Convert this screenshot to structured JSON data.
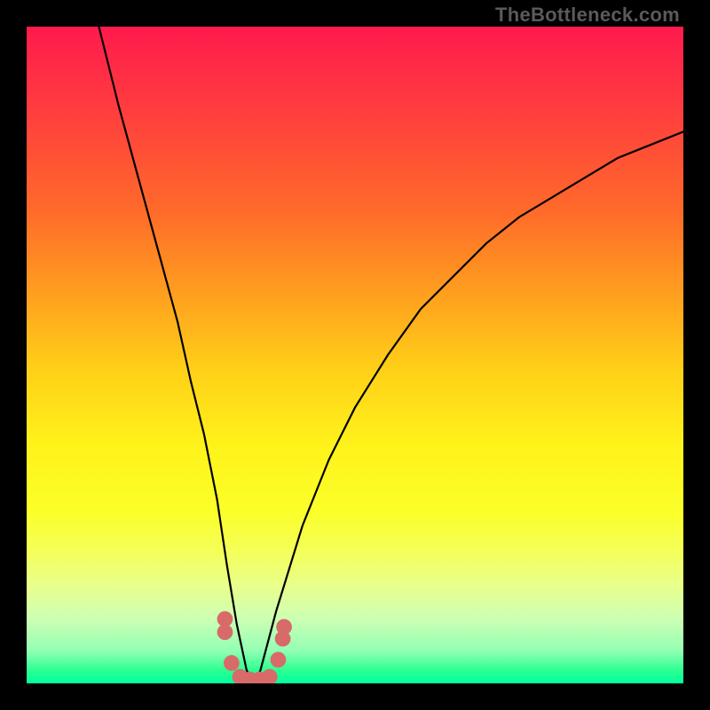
{
  "watermark": "TheBottleneck.com",
  "chart_data": {
    "type": "line",
    "title": "",
    "xlabel": "",
    "ylabel": "",
    "xlim": [
      0,
      100
    ],
    "ylim": [
      0,
      100
    ],
    "background": {
      "type": "vertical-gradient",
      "stops": [
        {
          "pct": 0,
          "color": "#ff1a4d"
        },
        {
          "pct": 28,
          "color": "#ff6a2a"
        },
        {
          "pct": 52,
          "color": "#ffcf18"
        },
        {
          "pct": 74,
          "color": "#fbff2a"
        },
        {
          "pct": 90,
          "color": "#cfffb3"
        },
        {
          "pct": 100,
          "color": "#00ff9e"
        }
      ]
    },
    "series": [
      {
        "name": "curve",
        "color": "#000000",
        "x": [
          11,
          14,
          17,
          20,
          23,
          25,
          27,
          29,
          30.5,
          32,
          33.5,
          34.6,
          35.6,
          38,
          42,
          46,
          50,
          55,
          60,
          65,
          70,
          75,
          80,
          85,
          90,
          95,
          100
        ],
        "y": [
          100,
          88,
          77,
          66,
          55,
          46,
          38,
          28,
          18,
          9,
          2,
          0,
          2,
          11,
          24,
          34,
          42,
          50,
          57,
          62,
          67,
          71,
          74,
          77,
          80,
          82,
          84
        ]
      }
    ],
    "markers": {
      "name": "bottom-cluster",
      "color": "#d86a6a",
      "radius_pct": 1.2,
      "points": [
        {
          "x": 30.2,
          "y": 9.8
        },
        {
          "x": 30.2,
          "y": 7.8
        },
        {
          "x": 31.2,
          "y": 3.1
        },
        {
          "x": 32.5,
          "y": 1.0
        },
        {
          "x": 34.0,
          "y": 0.6
        },
        {
          "x": 35.5,
          "y": 0.6
        },
        {
          "x": 37.0,
          "y": 1.0
        },
        {
          "x": 38.3,
          "y": 3.6
        },
        {
          "x": 39.0,
          "y": 6.8
        },
        {
          "x": 39.2,
          "y": 8.6
        }
      ]
    }
  }
}
